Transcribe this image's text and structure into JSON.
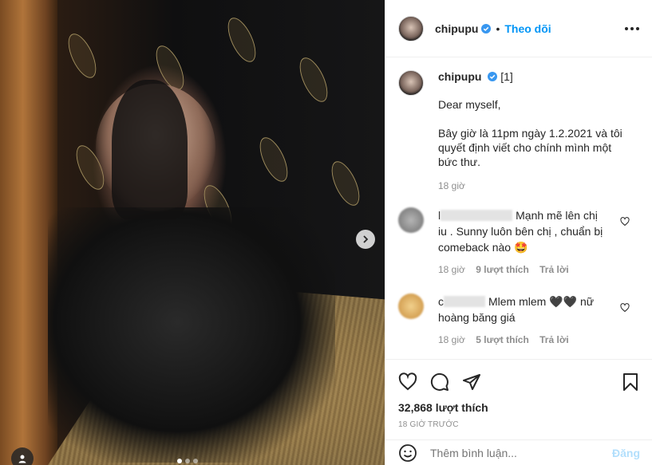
{
  "post": {
    "username": "chipupu",
    "follow_label": "Theo dõi",
    "separator": "•"
  },
  "caption": {
    "username": "chipupu",
    "ref": "[1]",
    "line1": "Dear myself,",
    "line2": "Bây giờ là 11pm ngày 1.2.2021 và tôi quyết định viết cho chính mình một bức thư.",
    "time": "18 giờ"
  },
  "comments": [
    {
      "name_visible": "l",
      "text": "Mạnh mẽ lên chị iu . Sunny luôn bên chị , chuẩn bị comeback nào 🤩",
      "time": "18 giờ",
      "likes": "9 lượt thích",
      "reply": "Trả lời",
      "avatar_color": "#8a8a8a"
    },
    {
      "name_visible": "c",
      "text": "Mlem mlem 🖤🖤 nữ hoàng băng giá",
      "time": "18 giờ",
      "likes": "5 lượt thích",
      "reply": "Trả lời",
      "avatar_color": "#e0b06a"
    }
  ],
  "stats": {
    "likes": "32,868 lượt thích",
    "ago": "18 GIỜ TRƯỚC"
  },
  "add_comment": {
    "placeholder": "Thêm bình luận...",
    "post_label": "Đăng"
  },
  "icons": {
    "verified": "verified-badge-icon",
    "more": "more-options-icon",
    "heart": "heart-icon",
    "comment": "comment-icon",
    "share": "share-icon",
    "save": "bookmark-icon",
    "emoji": "emoji-icon",
    "next": "chevron-right-icon",
    "tag": "user-tag-icon"
  },
  "colors": {
    "accent": "#0095f6",
    "verified": "#3897f0",
    "muted": "#8e8e8e"
  }
}
